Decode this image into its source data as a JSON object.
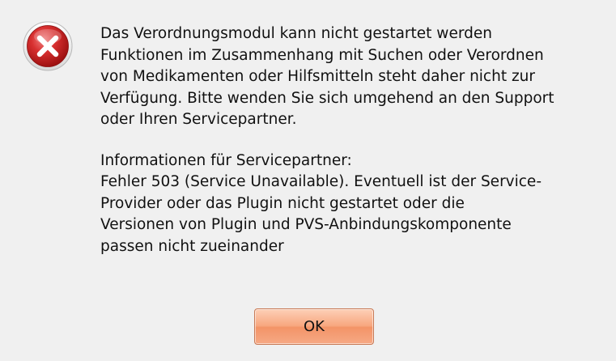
{
  "dialog": {
    "icon": "error-icon",
    "message_lines": [
      "Das Verordnungsmodul kann nicht gestartet werden",
      "Funktionen im Zusammenhang mit Suchen oder Verordnen",
      "von Medikamenten oder Hilfsmitteln steht daher nicht zur",
      "Verfügung. Bitte wenden Sie sich umgehend an den Support",
      "oder Ihren Servicepartner."
    ],
    "info_lines": [
      "Informationen für Servicepartner:",
      "Fehler 503 (Service Unavailable). Eventuell ist der Service-",
      "Provider oder das Plugin nicht gestartet oder die",
      "Versionen von Plugin und PVS-Anbindungskomponente",
      "passen nicht zueinander"
    ],
    "ok_label": "OK"
  },
  "colors": {
    "background": "#f0f0f0",
    "error_red": "#d42a2a",
    "button_accent": "#f39467"
  }
}
